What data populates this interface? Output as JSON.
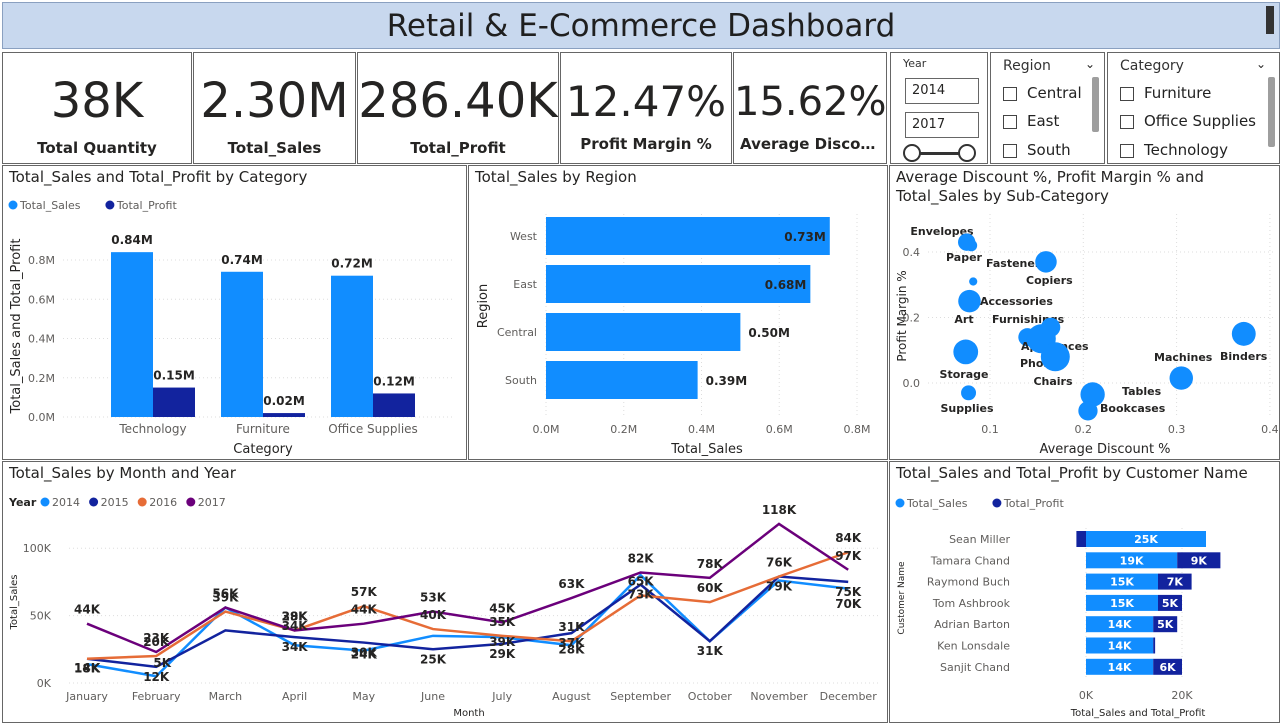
{
  "header": {
    "title": "Retail & E-Commerce Dashboard"
  },
  "kpis": [
    {
      "value": "38K",
      "label": "Total Quantity"
    },
    {
      "value": "2.30M",
      "label": "Total_Sales"
    },
    {
      "value": "286.40K",
      "label": "Total_Profit"
    },
    {
      "value": "12.47%",
      "label": "Profit Margin %"
    },
    {
      "value": "15.62%",
      "label": "Average Discou..."
    }
  ],
  "slicers": {
    "year": {
      "title": "Year",
      "from": "2014",
      "to": "2017"
    },
    "region": {
      "title": "Region",
      "items": [
        "Central",
        "East",
        "South"
      ]
    },
    "category": {
      "title": "Category",
      "items": [
        "Furniture",
        "Office Supplies",
        "Technology"
      ]
    }
  },
  "colors": {
    "blue": "#118dff",
    "navy": "#12239e",
    "orange": "#e66c37",
    "purple": "#6b007b"
  },
  "chart_data": [
    {
      "type": "bar",
      "title": "Total_Sales and Total_Profit by Category",
      "xlabel": "Category",
      "ylabel": "Total_Sales and Total_Profit",
      "categories": [
        "Technology",
        "Furniture",
        "Office Supplies"
      ],
      "series": [
        {
          "name": "Total_Sales",
          "values": [
            0.84,
            0.74,
            0.72
          ],
          "labels": [
            "0.84M",
            "0.74M",
            "0.72M"
          ]
        },
        {
          "name": "Total_Profit",
          "values": [
            0.15,
            0.02,
            0.12
          ],
          "labels": [
            "0.15M",
            "0.02M",
            "0.12M"
          ]
        }
      ],
      "yticks": [
        "0.0M",
        "0.2M",
        "0.4M",
        "0.6M",
        "0.8M"
      ],
      "ylim": [
        0,
        0.8
      ],
      "legend": "top-left"
    },
    {
      "type": "bar",
      "orientation": "horizontal",
      "title": "Total_Sales by Region",
      "xlabel": "Total_Sales",
      "ylabel": "Region",
      "categories": [
        "West",
        "East",
        "Central",
        "South"
      ],
      "values": [
        0.73,
        0.68,
        0.5,
        0.39
      ],
      "labels": [
        "0.73M",
        "0.68M",
        "0.50M",
        "0.39M"
      ],
      "xticks": [
        "0.0M",
        "0.2M",
        "0.4M",
        "0.6M",
        "0.8M"
      ],
      "xlim": [
        0,
        0.8
      ]
    },
    {
      "type": "scatter",
      "title": "Average Discount %, Profit Margin % and Total_Sales by Sub-Category",
      "xlabel": "Average Discount %",
      "ylabel": "Profit Margin %",
      "xticks": [
        "0.1",
        "0.2",
        "0.3",
        "0.4"
      ],
      "yticks": [
        "0.0",
        "0.2",
        "0.4"
      ],
      "xlim": [
        0.03,
        0.4
      ],
      "ylim": [
        -0.1,
        0.46
      ],
      "points": [
        {
          "name": "Envelopes",
          "x": 0.08,
          "y": 0.42,
          "size": 0.02
        },
        {
          "name": "Paper",
          "x": 0.075,
          "y": 0.43,
          "size": 0.08
        },
        {
          "name": "Fasteners",
          "x": 0.082,
          "y": 0.31,
          "size": 0.003
        },
        {
          "name": "Copiers",
          "x": 0.16,
          "y": 0.37,
          "size": 0.15
        },
        {
          "name": "Accessories",
          "x": 0.078,
          "y": 0.25,
          "size": 0.17
        },
        {
          "name": "Art",
          "x": 0.075,
          "y": 0.24,
          "size": 0.03
        },
        {
          "name": "Furnishings",
          "x": 0.14,
          "y": 0.14,
          "size": 0.09
        },
        {
          "name": "Appliances",
          "x": 0.165,
          "y": 0.17,
          "size": 0.11
        },
        {
          "name": "Phones",
          "x": 0.155,
          "y": 0.135,
          "size": 0.33
        },
        {
          "name": "Chairs",
          "x": 0.17,
          "y": 0.08,
          "size": 0.33
        },
        {
          "name": "Storage",
          "x": 0.074,
          "y": 0.095,
          "size": 0.22
        },
        {
          "name": "Supplies",
          "x": 0.077,
          "y": -0.03,
          "size": 0.05
        },
        {
          "name": "Machines",
          "x": 0.305,
          "y": 0.015,
          "size": 0.19
        },
        {
          "name": "Binders",
          "x": 0.372,
          "y": 0.15,
          "size": 0.2
        },
        {
          "name": "Tables",
          "x": 0.21,
          "y": -0.035,
          "size": 0.21
        },
        {
          "name": "Bookcases",
          "x": 0.205,
          "y": -0.085,
          "size": 0.11
        }
      ]
    },
    {
      "type": "line",
      "title": "Total_Sales by Month and Year",
      "xlabel": "Month",
      "ylabel": "Total_Sales",
      "legend_title": "Year",
      "categories": [
        "January",
        "February",
        "March",
        "April",
        "May",
        "June",
        "July",
        "August",
        "September",
        "October",
        "November",
        "December"
      ],
      "yticks": [
        "0K",
        "50K",
        "100K"
      ],
      "ylim": [
        0,
        125
      ],
      "series": [
        {
          "name": "2014",
          "values": [
            14,
            5,
            56,
            28,
            24,
            35,
            34,
            28,
            80,
            31,
            76,
            70
          ],
          "labels": [
            "14K",
            "",
            "",
            "",
            "24K",
            "",
            "",
            "28K",
            "",
            "",
            "",
            ""
          ]
        },
        {
          "name": "2015",
          "values": [
            18,
            12,
            39,
            34,
            30,
            25,
            29,
            37,
            73,
            31,
            79,
            75
          ],
          "labels": [
            "18K",
            "12K",
            "",
            "34K",
            "30K",
            "25K",
            "29K",
            "37K",
            "73K",
            "31K",
            "79K",
            "75K"
          ]
        },
        {
          "name": "2016",
          "values": [
            18,
            20,
            53,
            39,
            57,
            40,
            35,
            31,
            65,
            60,
            79,
            97
          ],
          "labels": [
            "",
            "20K",
            "39K",
            "28K",
            "57K",
            "40K",
            "35K",
            "31K",
            "65K",
            "60K",
            "76K",
            "84K"
          ]
        },
        {
          "name": "2017",
          "values": [
            44,
            23,
            56,
            39,
            44,
            53,
            45,
            63,
            82,
            78,
            118,
            84
          ],
          "labels": [
            "44K",
            "23K",
            "56K",
            "39K",
            "44K",
            "53K",
            "45K",
            "63K",
            "82K",
            "78K",
            "118K",
            "97K"
          ]
        }
      ],
      "extra_labels": [
        "5K",
        "34K",
        "39K",
        "70K"
      ]
    },
    {
      "type": "bar",
      "orientation": "horizontal",
      "stacked": true,
      "title": "Total_Sales and Total_Profit by Customer Name",
      "xlabel": "Total_Sales and Total_Profit",
      "ylabel": "Customer Name",
      "categories": [
        "Sean Miller",
        "Tamara Chand",
        "Raymond Buch",
        "Tom Ashbrook",
        "Adrian Barton",
        "Ken Lonsdale",
        "Sanjit Chand"
      ],
      "series": [
        {
          "name": "Total_Sales",
          "values": [
            25,
            19,
            15,
            15,
            14,
            14,
            14
          ],
          "labels": [
            "25K",
            "19K",
            "15K",
            "15K",
            "14K",
            "14K",
            "14K"
          ]
        },
        {
          "name": "Total_Profit",
          "values": [
            -2,
            9,
            7,
            5,
            5,
            0.4,
            6
          ],
          "labels": [
            "",
            "9K",
            "7K",
            "5K",
            "5K",
            "",
            "6K"
          ]
        }
      ],
      "xticks": [
        "0K",
        "20K"
      ],
      "xlim": [
        0,
        30
      ]
    }
  ]
}
